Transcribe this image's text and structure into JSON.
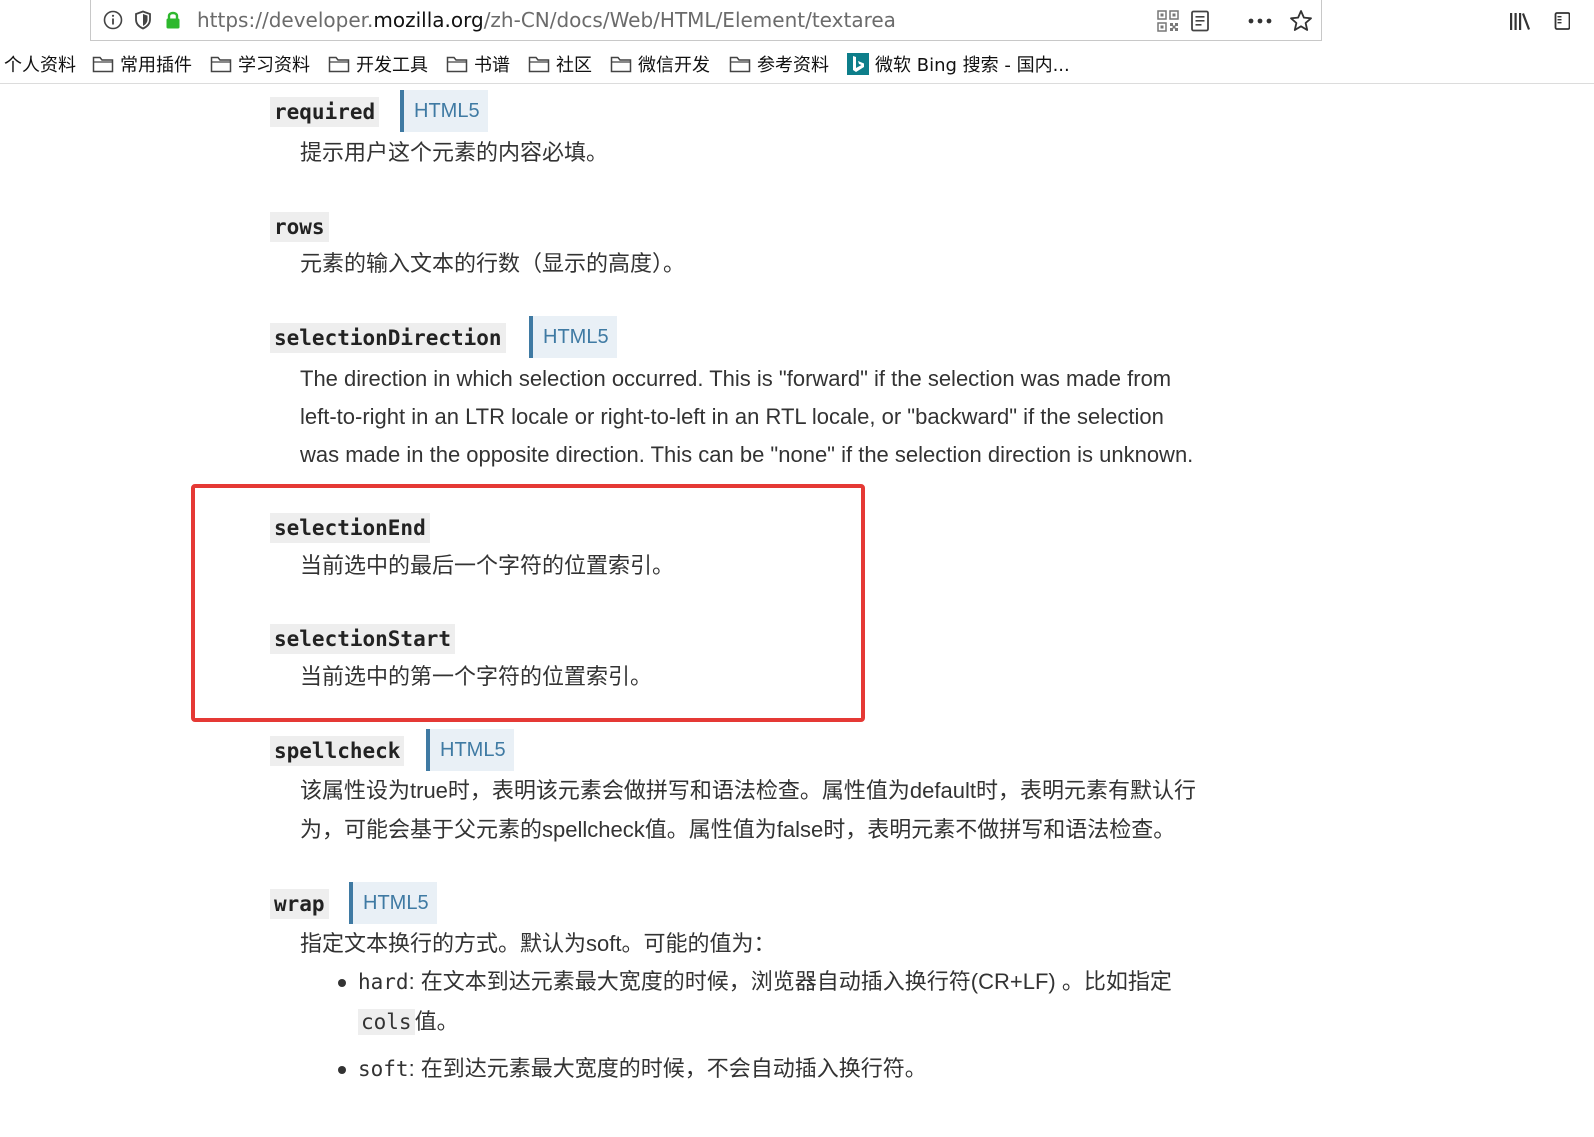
{
  "browser": {
    "url_prefix": "https://developer.",
    "url_domain": "mozilla.org",
    "url_path": "/zh-CN/docs/Web/HTML/Element/textarea",
    "icons": [
      "info-icon",
      "shield-icon",
      "lock-icon",
      "qr-code-icon",
      "reader-view-icon",
      "more-icon",
      "star-icon",
      "library-icon",
      "sidebar-icon"
    ]
  },
  "bookmarks": [
    {
      "label": "个人资料",
      "icon": "none"
    },
    {
      "label": "常用插件",
      "icon": "folder-icon"
    },
    {
      "label": "学习资料",
      "icon": "folder-icon"
    },
    {
      "label": "开发工具",
      "icon": "folder-icon"
    },
    {
      "label": "书谱",
      "icon": "folder-icon"
    },
    {
      "label": "社区",
      "icon": "folder-icon"
    },
    {
      "label": "微信开发",
      "icon": "folder-icon"
    },
    {
      "label": "参考资料",
      "icon": "folder-icon"
    },
    {
      "label": "微软 Bing 搜索 - 国内...",
      "icon": "bing-icon"
    }
  ],
  "attributes": {
    "required": {
      "name": "required",
      "badge": "HTML5",
      "desc": "提示用户这个元素的内容必填。"
    },
    "rows": {
      "name": "rows",
      "desc": "元素的输入文本的行数（显示的高度）。"
    },
    "selectionDirection": {
      "name": "selectionDirection",
      "badge": "HTML5",
      "desc": [
        "The direction in which selection occurred. This is \"forward\" if the selection was made from",
        "left-to-right in an LTR locale or right-to-left in an RTL locale, or \"backward\" if the selection",
        "was made in the opposite direction. This can be \"none\" if the selection direction is unknown."
      ]
    },
    "selectionEnd": {
      "name": "selectionEnd",
      "desc": "当前选中的最后一个字符的位置索引。"
    },
    "selectionStart": {
      "name": "selectionStart",
      "desc": "当前选中的第一个字符的位置索引。"
    },
    "spellcheck": {
      "name": "spellcheck",
      "badge": "HTML5",
      "desc": [
        "该属性设为true时，表明该元素会做拼写和语法检查。属性值为default时，表明元素有默认行",
        "为，可能会基于父元素的spellcheck值。属性值为false时，表明元素不做拼写和语法检查。"
      ]
    },
    "wrap": {
      "name": "wrap",
      "badge": "HTML5",
      "desc": "指定文本换行的方式。默认为soft。可能的值为：",
      "items": [
        {
          "code": "hard",
          "text_1": ": 在文本到达元素最大宽度的时候，浏览器自动插入换行符(CR+LF) 。比如指定",
          "code_2": "cols",
          "text_2": "值。"
        },
        {
          "code": "soft",
          "text_1": ": 在到达元素最大宽度的时候，不会自动插入换行符。"
        }
      ]
    }
  },
  "colors": {
    "highlight": "#e53935",
    "badge_text": "#3f7aa3",
    "badge_bg": "#e9f0f6",
    "lock": "#2eb82e"
  }
}
